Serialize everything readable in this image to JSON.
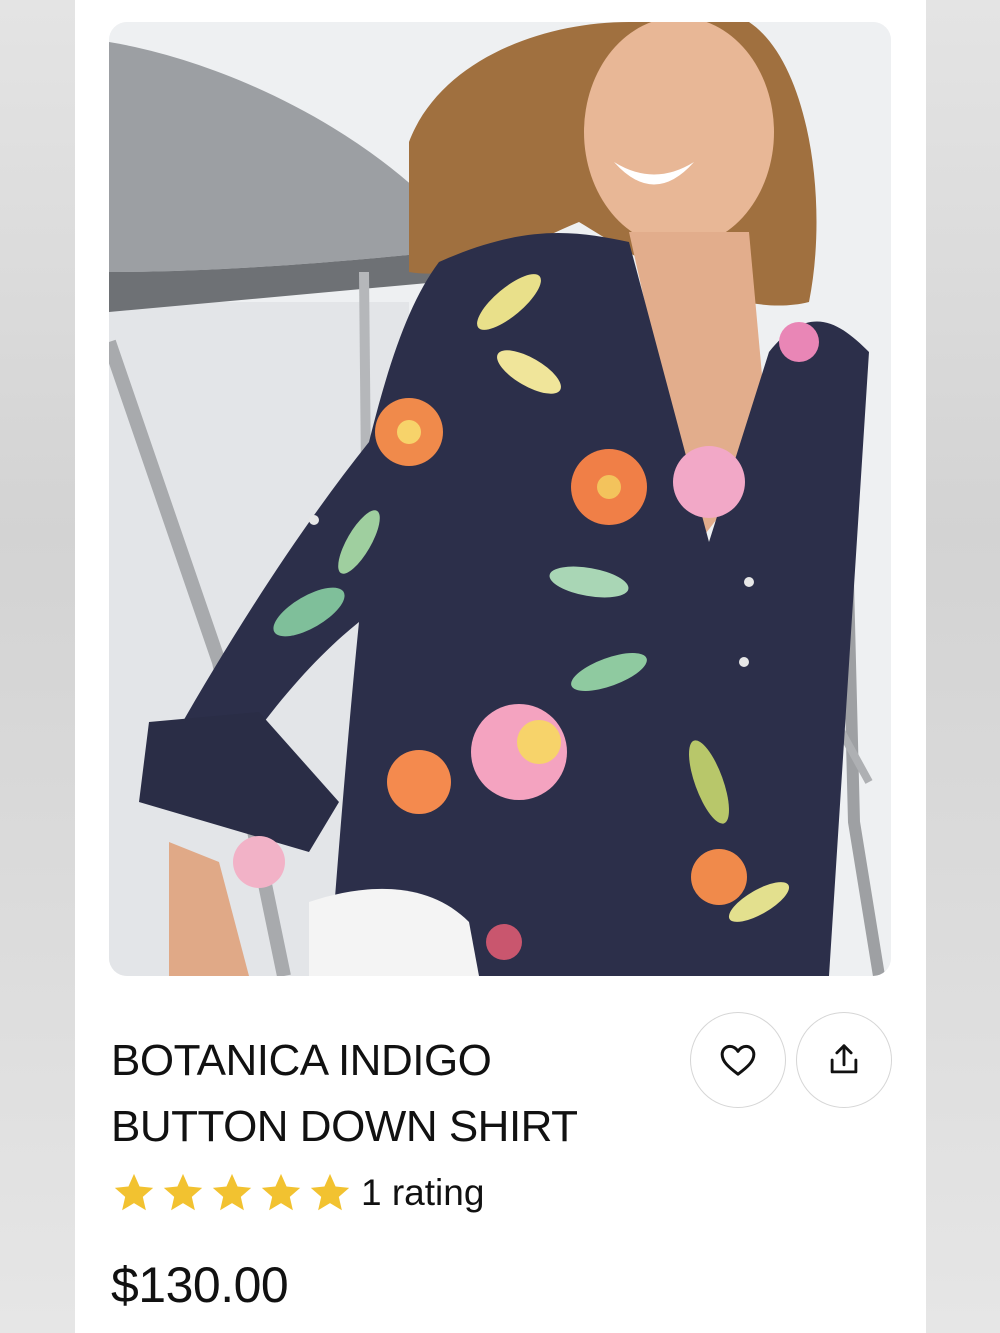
{
  "product": {
    "title_line1": "BOTANICA INDIGO",
    "title_line2": "BUTTON DOWN SHIRT",
    "rating_stars": 5,
    "rating_text": "1 rating",
    "price": "$130.00",
    "image_icon": "product-photo"
  },
  "actions": {
    "wishlist_icon": "heart-icon",
    "share_icon": "share-icon"
  },
  "colors": {
    "star": "#F2C230",
    "text": "#111111",
    "shirt": "#2c2f4a"
  }
}
